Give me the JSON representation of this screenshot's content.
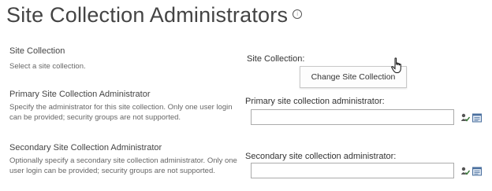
{
  "page": {
    "title": "Site Collection Administrators",
    "info_icon": "info-icon"
  },
  "sections": {
    "site_collection": {
      "title": "Site Collection",
      "description": "Select a site collection.",
      "field_label": "Site Collection:",
      "button_label": "Change Site Collection"
    },
    "primary_admin": {
      "title": "Primary Site Collection Administrator",
      "description": "Specify the administrator for this site collection. Only one user login can be provided; security groups are not supported.",
      "field_label": "Primary site collection administrator:",
      "value": ""
    },
    "secondary_admin": {
      "title": "Secondary Site Collection Administrator",
      "description": "Optionally specify a secondary site collection administrator. Only one user login can be provided; security groups are not supported.",
      "field_label": "Secondary site collection administrator:",
      "value": ""
    }
  },
  "icons": {
    "check_names": "check-names-icon",
    "browse": "address-book-icon",
    "cursor": "hand-pointer-icon"
  }
}
